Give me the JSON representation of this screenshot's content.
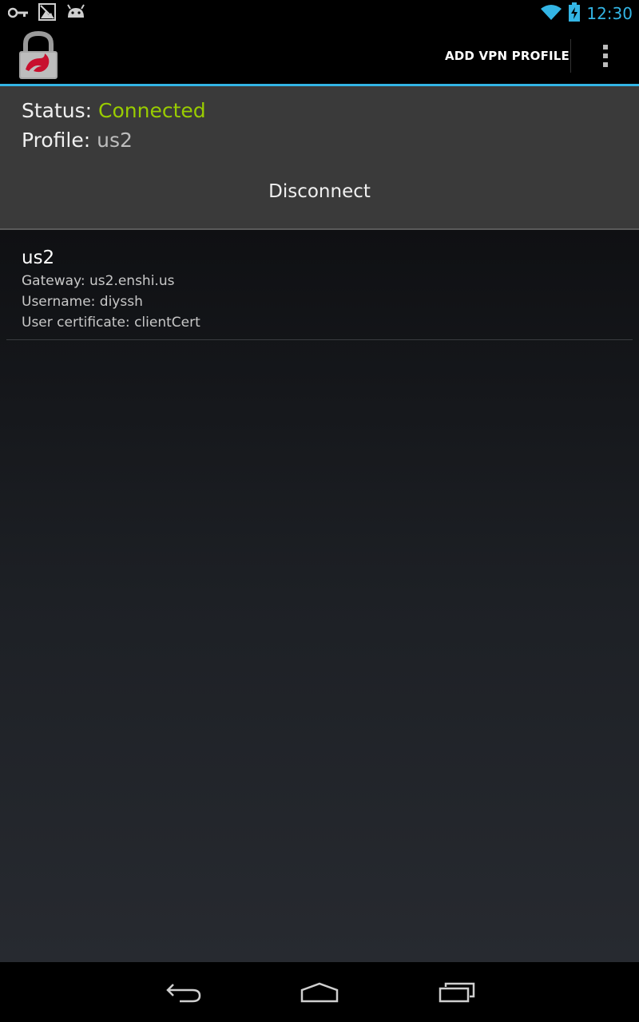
{
  "status_bar": {
    "time": "12:30",
    "accent_color": "#33b5e5",
    "left_icons": [
      "key-icon",
      "no-signal-image-icon",
      "android-debug-icon"
    ],
    "right_icons": [
      "wifi-icon",
      "battery-charging-icon"
    ]
  },
  "action_bar": {
    "app_icon": "strongswan-lock-icon",
    "add_profile_label": "ADD VPN PROFILE",
    "overflow_icon": "overflow-menu-icon"
  },
  "status_panel": {
    "status_label": "Status:",
    "status_value": "Connected",
    "status_color": "#99cc00",
    "profile_label": "Profile:",
    "profile_value": "us2",
    "disconnect_label": "Disconnect"
  },
  "profiles": [
    {
      "name": "us2",
      "gateway": "Gateway: us2.enshi.us",
      "username": "Username: diyssh",
      "certificate": "User certificate: clientCert"
    }
  ],
  "nav_bar": {
    "buttons": [
      "back-icon",
      "home-icon",
      "recent-apps-icon"
    ]
  }
}
